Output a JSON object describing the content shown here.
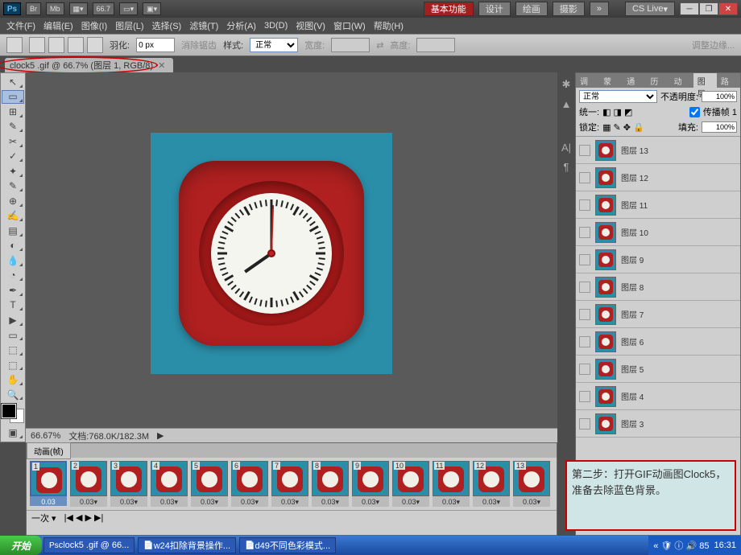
{
  "titlebar": {
    "logo": "Ps",
    "zoom_display": "66.7",
    "workspace_active": "基本功能",
    "workspaces": [
      "设计",
      "绘画",
      "摄影"
    ],
    "more": "»",
    "cslive": "CS Live",
    "win": {
      "min": "─",
      "max": "❐",
      "close": "✕"
    }
  },
  "menu": [
    "文件(F)",
    "编辑(E)",
    "图像(I)",
    "图层(L)",
    "选择(S)",
    "滤镜(T)",
    "分析(A)",
    "3D(D)",
    "视图(V)",
    "窗口(W)",
    "帮助(H)"
  ],
  "options": {
    "feather_label": "羽化:",
    "feather_val": "0 px",
    "antialias": "消除锯齿",
    "style_label": "样式:",
    "style_val": "正常",
    "width_label": "宽度:",
    "height_label": "高度:",
    "refine": "调整边缘..."
  },
  "doc_tab": {
    "title": "clock5 .gif @ 66.7% (图层 1, RGB/8)",
    "close": "✕"
  },
  "status": {
    "zoom": "66.67%",
    "doc_label": "文档:",
    "doc_size": "768.0K/182.3M"
  },
  "panel_tabs": [
    "调整",
    "蒙版",
    "通道",
    "历史",
    "动作",
    "图层",
    "路径"
  ],
  "layers": {
    "blend": "正常",
    "opacity_label": "不透明度:",
    "opacity_val": "100%",
    "unify_label": "统一:",
    "propagate": "传播帧 1",
    "lock_label": "锁定:",
    "fill_label": "填充:",
    "fill_val": "100%",
    "items": [
      {
        "name": "图层 13"
      },
      {
        "name": "图层 12"
      },
      {
        "name": "图层 11"
      },
      {
        "name": "图层 10"
      },
      {
        "name": "图层 9"
      },
      {
        "name": "图层 8"
      },
      {
        "name": "图层 7"
      },
      {
        "name": "图层 6"
      },
      {
        "name": "图层 5"
      },
      {
        "name": "图层 4"
      },
      {
        "name": "图层 3"
      }
    ]
  },
  "animation": {
    "tab": "动画(帧)",
    "frame_times": [
      "0.03",
      "0.03▾",
      "0.03▾",
      "0.03▾",
      "0.03▾",
      "0.03▾",
      "0.03▾",
      "0.03▾",
      "0.03▾",
      "0.03▾",
      "0.03▾",
      "0.03▾",
      "0.03▾"
    ],
    "loop": "一次",
    "controls": "▸"
  },
  "note_text": "第二步：打开GIF动画图Clock5，准备去除蓝色背景。",
  "taskbar": {
    "start": "开始",
    "items": [
      "clock5 .gif @ 66...",
      "w24扣除背景操作...",
      "d49不同色彩模式..."
    ],
    "tray_icons": "« 🛡 ⓘ 🔊 85",
    "time": "16:31"
  },
  "tools": [
    "↖",
    "▭",
    "⊞",
    "✂",
    "✎",
    "✓",
    "✦",
    "⊕",
    "✍",
    "▤",
    "◐",
    "✑",
    "⌫",
    "▼",
    "◧",
    "T",
    "▶",
    "▭",
    "✋",
    "🔍"
  ]
}
